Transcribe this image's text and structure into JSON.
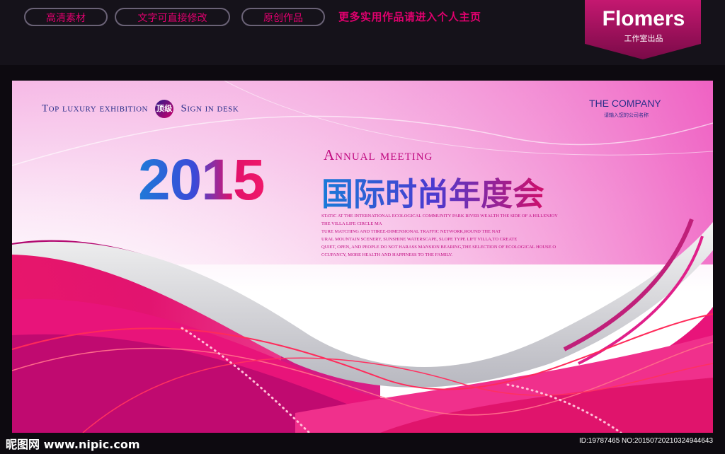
{
  "header": {
    "pills": [
      "高清素材",
      "文字可直接修改",
      "原创作品"
    ],
    "promo": "更多实用作品请进入个人主页",
    "brand_name": "Flomers",
    "brand_sub": "工作室出品"
  },
  "poster": {
    "tagline_left": "Top luxury exhibition",
    "badge": "顶级",
    "tagline_right": "Sign in desk",
    "company": "THE COMPANY",
    "company_sub": "请输入您的公司名称",
    "year": "2015",
    "annual": "Annual meeting",
    "title_cn": "国际时尚年度会",
    "body_lines": [
      "STATIC AT THE INTERNATIONAL ECOLOGICAL COMMUNITY PARK RIVER WEALTH THE SIDE OF A HILLENJOY",
      "THE VILLA LIFE CIRCLE MA",
      "TURE MATCHING AND THREE-DIMENSIONAL TRAFFIC NETWORK,ROUND THE NAT",
      "URAL MOUNTAIN SCENERY, SUNSHINE WATERSCAPE, SLOPE TYPE LIFT VILLA,TO CREATE",
      "QUIET, OPEN, AND PEOPLE DO NOT HARASS MANSION BEARING,THE SELECTION OF ECOLOGICAL HOUSE O",
      "CCUPANCY, MORE HEALTH AND HAPPINESS TO THE FAMILY."
    ]
  },
  "footer": {
    "logo": "昵图网 www.nipic.com",
    "id_text": "ID:19787465 NO:20150720210324944643"
  },
  "colors": {
    "accent_pink": "#e0006e",
    "poster_magenta": "#c00a80",
    "poster_blue": "#2a2f8a"
  }
}
